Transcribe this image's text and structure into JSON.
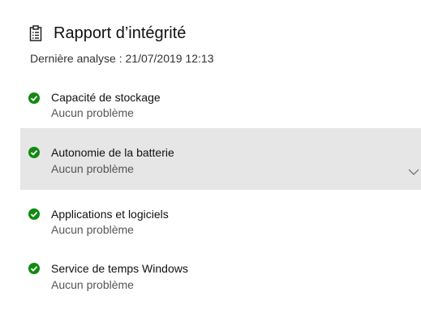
{
  "header": {
    "title": "Rapport d’intégrité",
    "icon": "clipboard-checklist-icon"
  },
  "last_scan": "Dernière analyse : 21/07/2019 12:13",
  "items": [
    {
      "title": "Capacité de stockage",
      "status": "Aucun problème",
      "icon": "check-circle-icon",
      "selected": false
    },
    {
      "title": "Autonomie de la batterie",
      "status": "Aucun problème",
      "icon": "check-circle-icon",
      "selected": true
    },
    {
      "title": "Applications et logiciels",
      "status": "Aucun problème",
      "icon": "check-circle-icon",
      "selected": false
    },
    {
      "title": "Service de temps Windows",
      "status": "Aucun problème",
      "icon": "check-circle-icon",
      "selected": false
    }
  ],
  "colors": {
    "status_ok": "#108a10",
    "selected_background": "#e6e6e6"
  }
}
